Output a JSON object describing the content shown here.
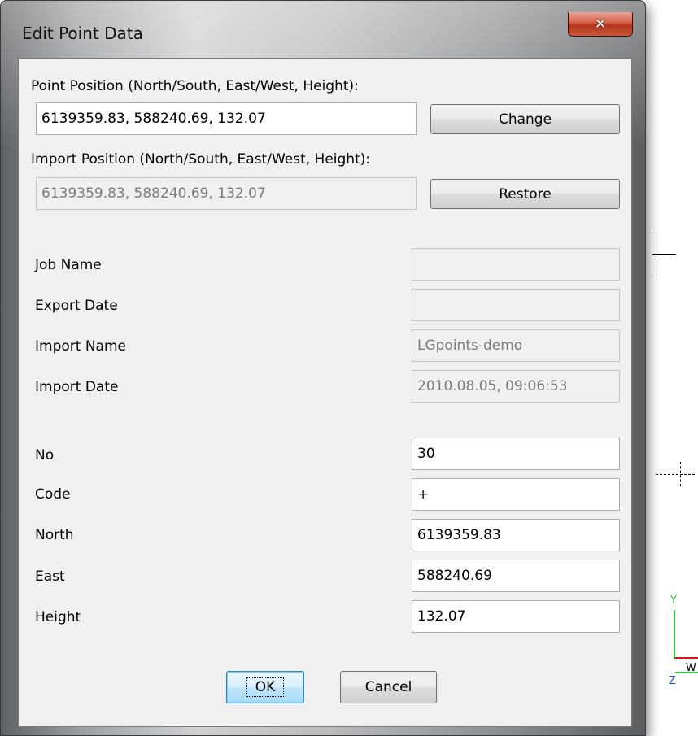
{
  "window": {
    "title": "Edit Point Data",
    "close_glyph": "✕"
  },
  "position": {
    "label": "Point Position (North/South, East/West, Height):",
    "value": "6139359.83, 588240.69, 132.07",
    "change_label": "Change"
  },
  "import_position": {
    "label": "Import Position (North/South, East/West, Height):",
    "value": "6139359.83, 588240.69, 132.07",
    "restore_label": "Restore"
  },
  "info": {
    "job_name_label": "Job Name",
    "job_name_value": "",
    "export_date_label": "Export Date",
    "export_date_value": "",
    "import_name_label": "Import Name",
    "import_name_value": "LGpoints-demo",
    "import_date_label": "Import Date",
    "import_date_value": "2010.08.05, 09:06:53"
  },
  "fields": {
    "no_label": "No",
    "no_value": "30",
    "code_label": "Code",
    "code_value": "+",
    "north_label": "North",
    "north_value": "6139359.83",
    "east_label": "East",
    "east_value": "588240.69",
    "height_label": "Height",
    "height_value": "132.07"
  },
  "buttons": {
    "ok_label": "OK",
    "cancel_label": "Cancel"
  },
  "background": {
    "y_axis_label": "Y",
    "z_axis_label": "Z",
    "w_label": "W"
  },
  "colors": {
    "y_axis": "#2ecc40",
    "x_axis": "#e01010",
    "z_axis": "#1a4fd6"
  }
}
